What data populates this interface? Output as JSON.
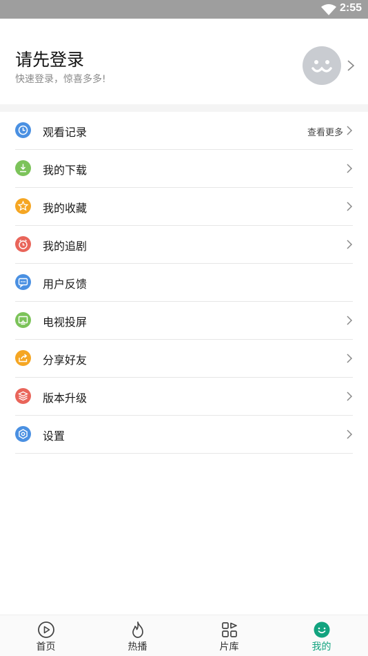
{
  "status_bar": {
    "time": "2:55"
  },
  "profile": {
    "title": "请先登录",
    "subtitle": "快速登录，惊喜多多!"
  },
  "menu": [
    {
      "label": "观看记录",
      "icon": "clock-icon",
      "color": "#4a90e2",
      "extra": "查看更多"
    },
    {
      "label": "我的下载",
      "icon": "download-icon",
      "color": "#7cc35a"
    },
    {
      "label": "我的收藏",
      "icon": "star-icon",
      "color": "#f5a623"
    },
    {
      "label": "我的追剧",
      "icon": "alarm-icon",
      "color": "#e9655a"
    },
    {
      "label": "用户反馈",
      "icon": "message-icon",
      "color": "#4a90e2"
    },
    {
      "label": "电视投屏",
      "icon": "tv-icon",
      "color": "#7cc35a"
    },
    {
      "label": "分享好友",
      "icon": "share-icon",
      "color": "#f5a623"
    },
    {
      "label": "版本升级",
      "icon": "layers-icon",
      "color": "#e9655a"
    },
    {
      "label": "设置",
      "icon": "gear-icon",
      "color": "#4a90e2"
    }
  ],
  "tabs": [
    {
      "label": "首页",
      "icon": "play-circle-icon"
    },
    {
      "label": "热播",
      "icon": "flame-icon"
    },
    {
      "label": "片库",
      "icon": "grid-icon"
    },
    {
      "label": "我的",
      "icon": "smiley-icon",
      "active": true
    }
  ],
  "colors": {
    "accent": "#12a37f",
    "status_bar": "#9e9e9e",
    "avatar": "#c9ccd1"
  }
}
